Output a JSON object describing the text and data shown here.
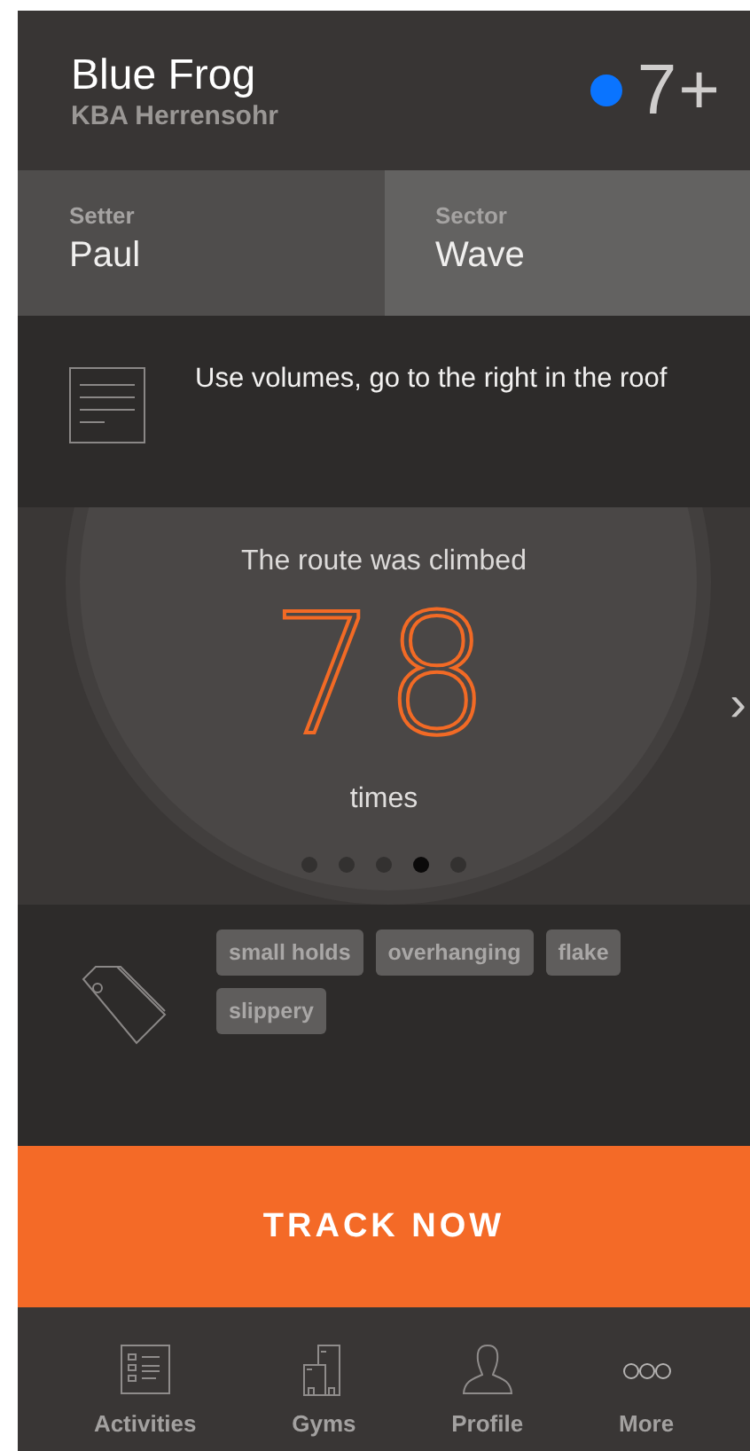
{
  "route": {
    "name": "Blue Frog",
    "gym": "KBA Herrensohr",
    "color": "#0a74ff",
    "grade": "7+"
  },
  "info": [
    {
      "label": "Setter",
      "value": "Paul"
    },
    {
      "label": "Sector",
      "value": "Wave"
    }
  ],
  "note": "Use volumes, go to the right in the roof",
  "stat": {
    "caption": "The route was climbed",
    "value": "78",
    "unit": "times",
    "next": "›"
  },
  "pages": [
    {
      "selected": false
    },
    {
      "selected": false
    },
    {
      "selected": false
    },
    {
      "selected": true
    },
    {
      "selected": false
    }
  ],
  "tags": [
    "small holds",
    "overhanging",
    "flake",
    "slippery"
  ],
  "action": "TRACK NOW",
  "tab_bar": [
    {
      "kind": "activities",
      "label": "Activities"
    },
    {
      "kind": "gyms",
      "label": "Gyms"
    },
    {
      "kind": "profile",
      "label": "Profile"
    },
    {
      "kind": "more",
      "label": "More"
    }
  ]
}
